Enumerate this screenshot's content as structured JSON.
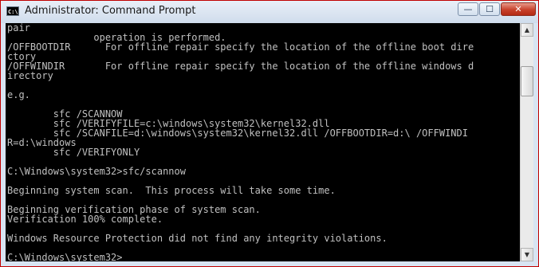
{
  "window": {
    "title": "Administrator: Command Prompt",
    "app_icon_text": "C:\\",
    "controls": {
      "minimize": "—",
      "maximize": "☐",
      "close": "✕"
    }
  },
  "console": {
    "lines": [
      "pair",
      "               operation is performed.",
      "/OFFBOOTDIR      For offline repair specify the location of the offline boot dire",
      "ctory",
      "/OFFWINDIR       For offline repair specify the location of the offline windows d",
      "irectory",
      "",
      "e.g.",
      "",
      "        sfc /SCANNOW",
      "        sfc /VERIFYFILE=c:\\windows\\system32\\kernel32.dll",
      "        sfc /SCANFILE=d:\\windows\\system32\\kernel32.dll /OFFBOOTDIR=d:\\ /OFFWINDI",
      "R=d:\\windows",
      "        sfc /VERIFYONLY",
      "",
      "C:\\Windows\\system32>sfc/scannow",
      "",
      "Beginning system scan.  This process will take some time.",
      "",
      "Beginning verification phase of system scan.",
      "Verification 100% complete.",
      "",
      "Windows Resource Protection did not find any integrity violations.",
      "",
      "C:\\Windows\\system32>"
    ]
  },
  "scrollbar": {
    "up_arrow": "▲",
    "down_arrow": "▼"
  }
}
